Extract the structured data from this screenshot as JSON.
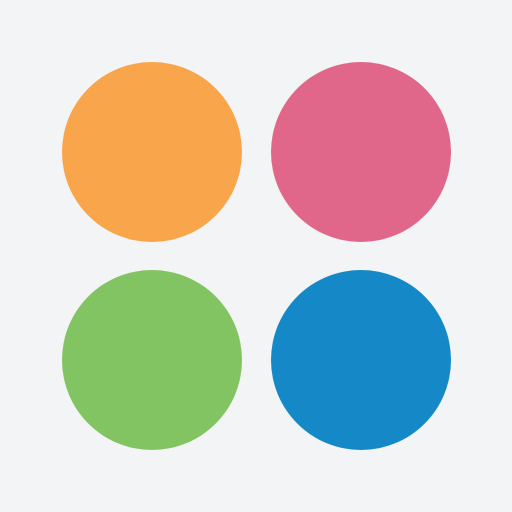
{
  "app_icon": {
    "name": "four-dots-logo",
    "background_color": "#f3f4f6",
    "dots": [
      {
        "name": "orange-dot",
        "color": "#f8a54b"
      },
      {
        "name": "pink-dot",
        "color": "#e1678a"
      },
      {
        "name": "green-dot",
        "color": "#82c462"
      },
      {
        "name": "blue-dot",
        "color": "#1588c8"
      }
    ]
  }
}
